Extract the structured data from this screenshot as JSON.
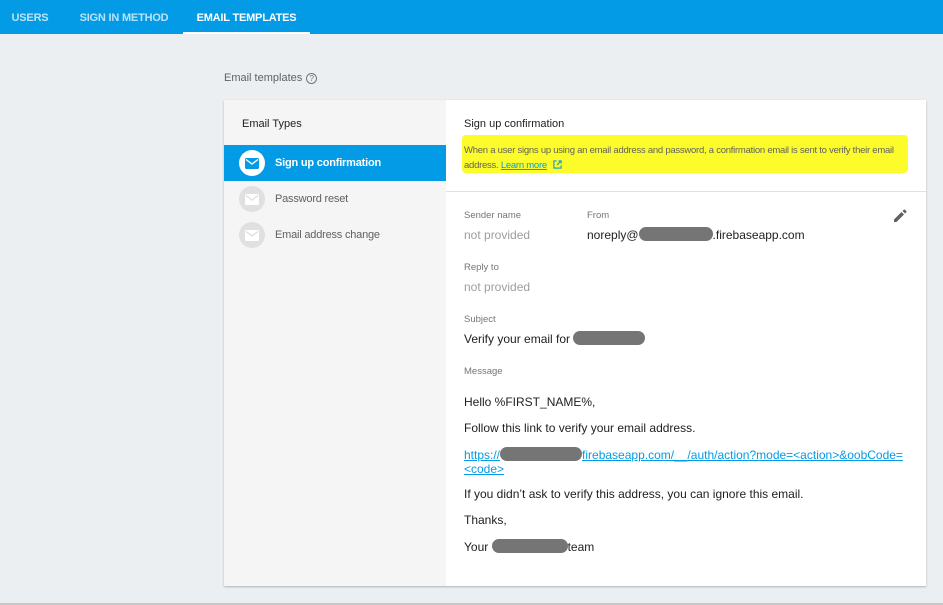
{
  "tabs": [
    {
      "label": "USERS",
      "active": false
    },
    {
      "label": "SIGN IN METHOD",
      "active": false
    },
    {
      "label": "EMAIL TEMPLATES",
      "active": true
    }
  ],
  "section": {
    "title": "Email templates",
    "help_icon": "help-circle-icon"
  },
  "sidebar": {
    "heading": "Email Types",
    "items": [
      {
        "label": "Sign up confirmation",
        "selected": true,
        "icon": "mail-icon"
      },
      {
        "label": "Password reset",
        "selected": false,
        "icon": "mail-icon"
      },
      {
        "label": "Email address change",
        "selected": false,
        "icon": "mail-icon"
      }
    ]
  },
  "template": {
    "title": "Sign up confirmation",
    "description": "When a user signs up using an email address and password, a confirmation email is sent to verify their email address.",
    "learn_more": "Learn more",
    "sender_name_label": "Sender name",
    "sender_name_value": "not provided",
    "from_label": "From",
    "from_prefix": "noreply@",
    "from_suffix": ".firebaseapp.com",
    "reply_to_label": "Reply to",
    "reply_to_value": "not provided",
    "subject_label": "Subject",
    "subject_prefix": "Verify your email for",
    "message_label": "Message",
    "message_greeting": "Hello %FIRST_NAME%,",
    "message_line1": "Follow this link to verify your email address.",
    "message_link_prefix": "https://",
    "message_link_suffix": "firebaseapp.com/__/auth/action?mode=<action>&oobCode=",
    "message_link_line2": "<code>",
    "message_line2": "If you didn’t ask to verify this address, you can ignore this email.",
    "message_thanks": "Thanks,",
    "message_sign_prefix": "Your",
    "message_sign_suffix": "team"
  },
  "colors": {
    "accent": "#039be5",
    "highlight": "#fcfc2a",
    "background": "#eceff1"
  }
}
